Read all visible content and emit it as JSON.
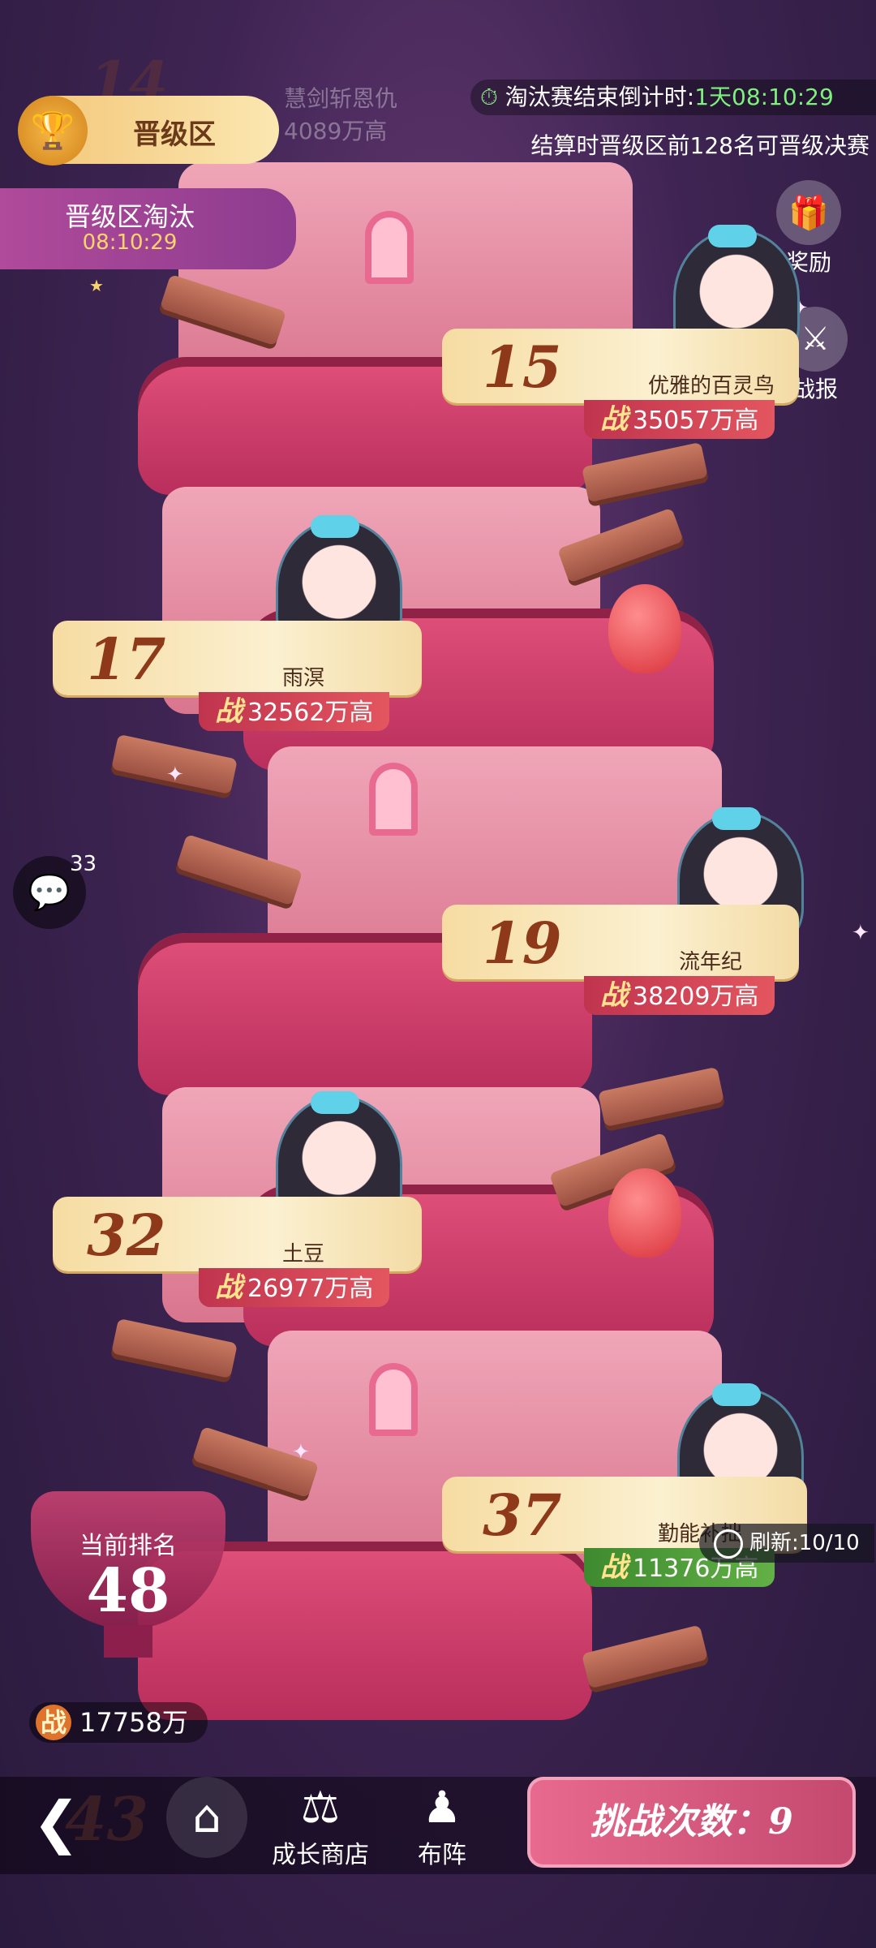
{
  "zone": {
    "label": "晋级区"
  },
  "elimination": {
    "title": "晋级区淘汰",
    "timer": "08:10:29"
  },
  "countdown": {
    "label": "淘汰赛结束倒计时:",
    "value": "1天08:10:29"
  },
  "promotion_note": "结算时晋级区前128名可晋级决赛",
  "side_buttons": {
    "reward": "奖励",
    "report": "战报"
  },
  "faded_top": {
    "rank": "14",
    "name": "慧剑斩恩仇",
    "power": "4089万高"
  },
  "cards": [
    {
      "rank": "15",
      "name": "优雅的百灵鸟",
      "power": "35057万高"
    },
    {
      "rank": "17",
      "name": "雨溟",
      "power": "32562万高"
    },
    {
      "rank": "19",
      "name": "流年纪",
      "power": "38209万高"
    },
    {
      "rank": "32",
      "name": "土豆",
      "power": "26977万高"
    },
    {
      "rank": "37",
      "name": "勤能补拙",
      "power": "11376万高"
    }
  ],
  "power_prefix": "战",
  "chat": {
    "count": "33"
  },
  "refresh": {
    "label": "刷新:10/10"
  },
  "current_rank": {
    "label": "当前排名",
    "value": "48"
  },
  "my_power": {
    "value": "17758万"
  },
  "faded_bottom": {
    "rank": "43"
  },
  "nav": {
    "shop": "成长商店",
    "lineup": "布阵"
  },
  "challenge": {
    "label": "挑战次数：9"
  },
  "colors": {
    "accent_gold": "#f3c577",
    "power_red": "#c0344e",
    "power_green": "#3e8a2f",
    "timer_green": "#7ef07e"
  }
}
